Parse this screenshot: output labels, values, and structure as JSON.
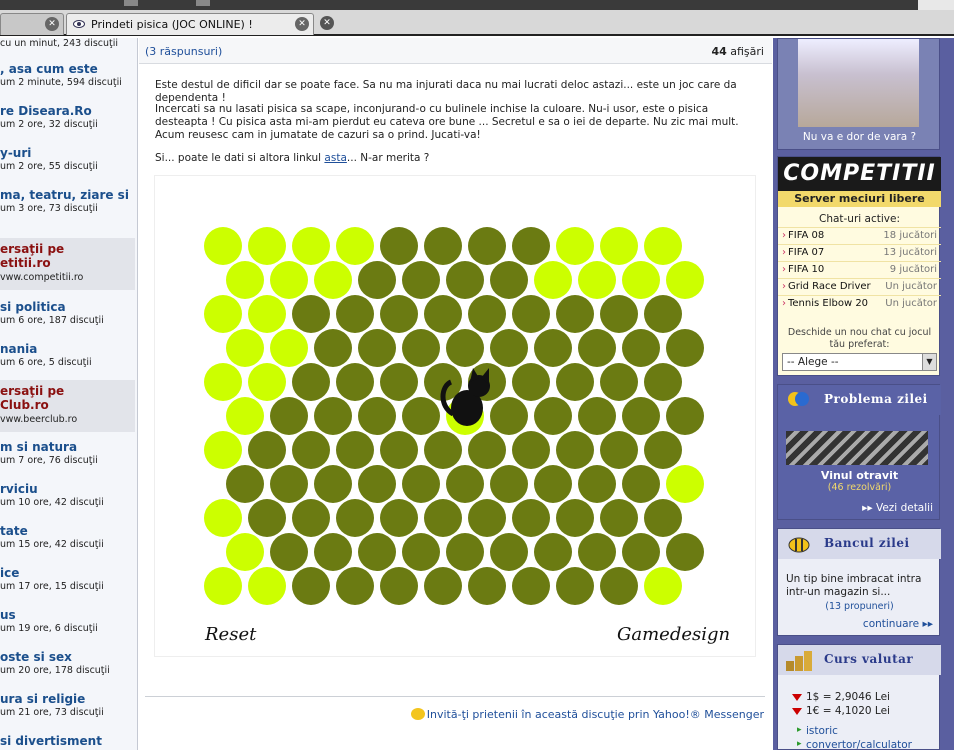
{
  "browser": {
    "tabs": [
      {
        "label": ""
      },
      {
        "label": "Prindeti pisica (JOC ONLINE) !"
      }
    ]
  },
  "sidebar": {
    "first_meta": "cu un minut, 243 discuţii",
    "items": [
      {
        "title": ", asa cum este",
        "meta": "um 2 minute, 594 discuţii",
        "hl": false
      },
      {
        "title": "re Diseara.Ro",
        "meta": "um 2 ore, 32 discuţii",
        "hl": false
      },
      {
        "title": "y-uri",
        "meta": "um 2 ore, 55 discuţii",
        "hl": false
      },
      {
        "title": "ma, teatru, ziare si",
        "meta": "um 3 ore, 73 discuţii",
        "hl": false
      },
      {
        "title": "ersaţii pe\netitii.ro",
        "meta": "vww.competitii.ro",
        "hl": true
      },
      {
        "title": "si politica",
        "meta": "um 6 ore, 187 discuţii",
        "hl": false
      },
      {
        "title": "nania",
        "meta": "um 6 ore, 5 discuţii",
        "hl": false
      },
      {
        "title": "ersaţii pe\nClub.ro",
        "meta": "vww.beerclub.ro",
        "hl": true
      },
      {
        "title": "m si natura",
        "meta": "um 7 ore, 76 discuţii",
        "hl": false
      },
      {
        "title": "rviciu",
        "meta": "um 10 ore, 42 discuţii",
        "hl": false
      },
      {
        "title": "tate",
        "meta": "um 15 ore, 42 discuţii",
        "hl": false
      },
      {
        "title": "ice",
        "meta": "um 17 ore, 15 discuţii",
        "hl": false
      },
      {
        "title": "us",
        "meta": "um 19 ore, 6 discuţii",
        "hl": false
      },
      {
        "title": "oste si sex",
        "meta": "um 20 ore, 178 discuţii",
        "hl": false
      },
      {
        "title": "ura si religie",
        "meta": "um 21 ore, 73 discuţii",
        "hl": false
      },
      {
        "title": "si divertisment",
        "meta": "",
        "hl": false
      }
    ]
  },
  "post": {
    "replies": "(3 răspunsuri)",
    "views_count": "44",
    "views_label": "afişări",
    "p1": "Este destul de dificil dar se poate face. Sa nu ma injurati daca nu mai lucrati deloc astazi... este un joc care da dependenta !",
    "p2": "Incercati sa nu lasati pisica sa scape, inconjurand-o cu bulinele inchise la culoare. Nu-i usor, este o pisica desteapta ! Cu pisica asta mi-am pierdut eu cateva ore bune ... Secretul e sa o iei de departe. Nu zic mai mult. Acum reusesc cam in jumatate de cazuri sa o prind. Jucati-va!",
    "p3_before": "Si... poate le dati si altora linkul ",
    "p3_link": "asta",
    "p3_after": "... N-ar merita ?",
    "invite": "Invită-ţi prietenii în această discuţie prin Yahoo!® Messenger"
  },
  "game": {
    "reset_label": "Reset",
    "design_label": "Gamedesign",
    "colors": {
      "light": "#ccff00",
      "dark": "#6b7b12",
      "cat": "#111111"
    },
    "grid_rows": [
      "LLLLDDDDLLL",
      "LLLDDDDLLLL",
      "LLDDDDDDDDD",
      "LLDDDDDDDDD",
      "LLDDDDDDDDD",
      "LDDDDCDDDDD",
      "LDDDDDDDDDD",
      "DDDDDDDDDDL",
      "LDDDDDDDDDD",
      "LDDDDDDDDDD",
      "LLDDDDDDDDL"
    ]
  },
  "right": {
    "photo_caption": "Nu va e dor de vara ?",
    "comp": {
      "brand": "COMPETITII",
      "server": "Server meciuri libere",
      "chat_title": "Chat-uri active:",
      "rows": [
        {
          "game": "FIFA 08",
          "players": "18 jucători"
        },
        {
          "game": "FIFA 07",
          "players": "13 jucători"
        },
        {
          "game": "FIFA 10",
          "players": "9 jucători"
        },
        {
          "game": "Grid Race Driver",
          "players": "Un jucător"
        },
        {
          "game": "Tennis Elbow 20",
          "players": "Un jucător"
        }
      ],
      "hint": "Deschide un nou chat cu jocul tău preferat:",
      "select_value": "-- Alege --"
    },
    "problem": {
      "title": "Problema zilei",
      "name": "Vinul otravit",
      "count": "(46 rezolvări)",
      "details": "Vezi detalii"
    },
    "banc": {
      "title": "Bancul zilei",
      "text": "Un tip bine imbracat intra intr-un magazin si...",
      "count": "(13 propuneri)",
      "cont": "continuare"
    },
    "curs": {
      "title": "Curs valutar",
      "usd": "1$ = 2,9046 Lei",
      "eur": "1€ = 4,1020 Lei",
      "link1": "istoric",
      "link2": "convertor/calculator"
    }
  }
}
